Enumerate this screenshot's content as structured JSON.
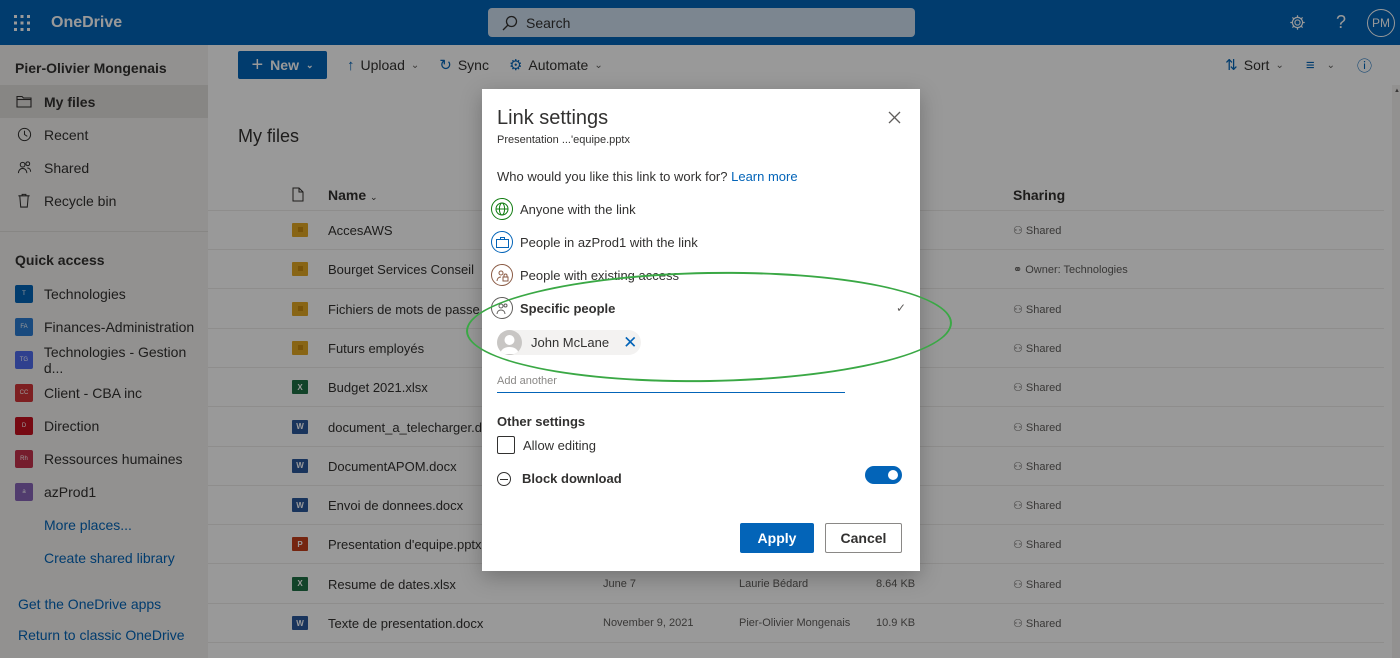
{
  "app": {
    "brand": "OneDrive",
    "search_placeholder": "Search",
    "avatar_initials": "PM"
  },
  "leftnav": {
    "user_name": "Pier-Olivier Mongenais",
    "items": [
      {
        "label": "My files",
        "icon": "folder-icon"
      },
      {
        "label": "Recent",
        "icon": "clock-icon"
      },
      {
        "label": "Shared",
        "icon": "people-icon"
      },
      {
        "label": "Recycle bin",
        "icon": "trash-icon"
      }
    ],
    "quick_access_title": "Quick access",
    "quick_access": [
      {
        "label": "Technologies",
        "badge": "T",
        "color": "#0364b8"
      },
      {
        "label": "Finances-Administration",
        "badge": "FA",
        "color": "#2b7cd3"
      },
      {
        "label": "Technologies - Gestion d...",
        "badge": "TG",
        "color": "#4f6bed"
      },
      {
        "label": "Client - CBA inc",
        "badge": "CC",
        "color": "#d13438"
      },
      {
        "label": "Direction",
        "badge": "D",
        "color": "#c50f1f"
      },
      {
        "label": "Ressources humaines",
        "badge": "Rh",
        "color": "#c4314b"
      },
      {
        "label": "azProd1",
        "badge": "a",
        "color": "#8764b8"
      }
    ],
    "more_places": "More places...",
    "create_library": "Create shared library",
    "get_apps": "Get the OneDrive apps",
    "classic": "Return to classic OneDrive"
  },
  "cmdbar": {
    "new": "New",
    "upload": "Upload",
    "sync": "Sync",
    "automate": "Automate",
    "sort": "Sort"
  },
  "main": {
    "title": "My files",
    "col_name": "Name",
    "col_sharing": "Sharing",
    "files": [
      {
        "name": "AccesAWS",
        "type": "folder",
        "modified": "",
        "by": "",
        "size": "",
        "sharing": "Shared"
      },
      {
        "name": "Bourget Services Conseil",
        "type": "folder-link",
        "modified": "",
        "by": "",
        "size": "",
        "sharing": "Owner: Technologies"
      },
      {
        "name": "Fichiers de mots de passe",
        "type": "folder",
        "modified": "",
        "by": "",
        "size": "",
        "sharing": "Shared"
      },
      {
        "name": "Futurs employés",
        "type": "folder",
        "modified": "",
        "by": "",
        "size": "",
        "sharing": "Shared"
      },
      {
        "name": "Budget 2021.xlsx",
        "type": "xlsx",
        "modified": "",
        "by": "",
        "size": "",
        "sharing": "Shared"
      },
      {
        "name": "document_a_telecharger.docx",
        "type": "docx",
        "modified": "",
        "by": "",
        "size": "",
        "sharing": "Shared"
      },
      {
        "name": "DocumentAPOM.docx",
        "type": "docx",
        "modified": "",
        "by": "",
        "size": "",
        "sharing": "Shared"
      },
      {
        "name": "Envoi de donnees.docx",
        "type": "docx",
        "modified": "",
        "by": "",
        "size": "",
        "sharing": "Shared"
      },
      {
        "name": "Presentation d'equipe.pptx",
        "type": "pptx",
        "modified": "",
        "by": "",
        "size": "",
        "sharing": "Shared"
      },
      {
        "name": "Resume de dates.xlsx",
        "type": "xlsx",
        "modified": "June 7",
        "by": "Laurie Bédard",
        "size": "8.64 KB",
        "sharing": "Shared"
      },
      {
        "name": "Texte de presentation.docx",
        "type": "docx",
        "modified": "November 9, 2021",
        "by": "Pier-Olivier Mongenais",
        "size": "10.9 KB",
        "sharing": "Shared"
      }
    ]
  },
  "dialog": {
    "title": "Link settings",
    "subtitle": "Presentation ...'equipe.pptx",
    "question": "Who would you like this link to work for?",
    "learn_more": "Learn more",
    "options": [
      {
        "label": "Anyone with the link",
        "icon": "globe-icon",
        "color": "#107c10",
        "selected": false
      },
      {
        "label": "People in azProd1 with the link",
        "icon": "briefcase-icon",
        "color": "#0364b8",
        "selected": false
      },
      {
        "label": "People with existing access",
        "icon": "people-lock-icon",
        "color": "#8a5a44",
        "selected": false
      },
      {
        "label": "Specific people",
        "icon": "people-icon",
        "color": "#605e5c",
        "selected": true
      }
    ],
    "person": "John McLane",
    "add_placeholder": "Add another",
    "other_settings": "Other settings",
    "allow_editing": "Allow editing",
    "block_download": "Block download",
    "block_download_on": true,
    "apply": "Apply",
    "cancel": "Cancel"
  }
}
